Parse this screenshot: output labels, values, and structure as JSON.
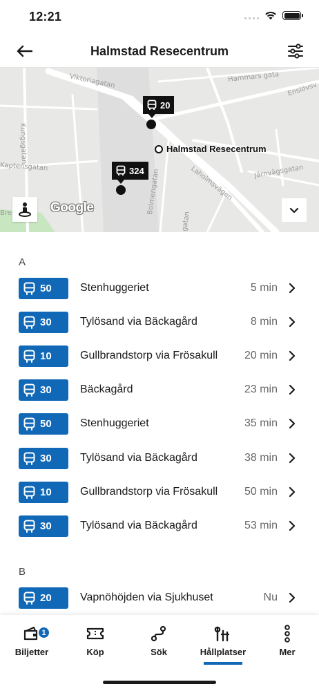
{
  "status": {
    "time": "12:21"
  },
  "header": {
    "title": "Halmstad Resecentrum"
  },
  "map": {
    "streets": [
      "Viktoriagatan",
      "Hammars gata",
      "Enslövsv",
      "Kungsgatan",
      "Kaptensgatan",
      "Laholmsvägen",
      "Järnvägsgatan",
      "Bolmengatan",
      "Brec",
      "gatan"
    ],
    "stops": [
      {
        "line": "20"
      },
      {
        "line": "324"
      }
    ],
    "station_label": "Halmstad Resecentrum",
    "google_logo": "Google",
    "colors": {
      "land": "#e8e8e6",
      "road": "#ffffff",
      "park": "#c8e6c0"
    }
  },
  "platforms": [
    {
      "label": "A",
      "departures": [
        {
          "line": "50",
          "destination": "Stenhuggeriet",
          "time": "5 min"
        },
        {
          "line": "30",
          "destination": "Tylösand via Bäckagård",
          "time": "8 min"
        },
        {
          "line": "10",
          "destination": "Gullbrandstorp via Frösakull",
          "time": "20 min"
        },
        {
          "line": "30",
          "destination": "Bäckagård",
          "time": "23 min"
        },
        {
          "line": "50",
          "destination": "Stenhuggeriet",
          "time": "35 min"
        },
        {
          "line": "30",
          "destination": "Tylösand via Bäckagård",
          "time": "38 min"
        },
        {
          "line": "10",
          "destination": "Gullbrandstorp via Frösakull",
          "time": "50 min"
        },
        {
          "line": "30",
          "destination": "Tylösand via Bäckagård",
          "time": "53 min"
        }
      ]
    },
    {
      "label": "B",
      "departures": [
        {
          "line": "20",
          "destination": "Vapnöhöjden via Sjukhuset",
          "time": "Nu"
        }
      ]
    }
  ],
  "nav": {
    "items": [
      {
        "label": "Biljetter",
        "icon": "ticket-wallet-icon",
        "badge": "1"
      },
      {
        "label": "Köp",
        "icon": "ticket-icon"
      },
      {
        "label": "Sök",
        "icon": "route-icon"
      },
      {
        "label": "Hållplatser",
        "icon": "stop-sign-icon",
        "active": true
      },
      {
        "label": "Mer",
        "icon": "more-icon"
      }
    ]
  },
  "theme": {
    "accent": "#1068b6",
    "text": "#1a1a1a",
    "muted": "#666666"
  }
}
